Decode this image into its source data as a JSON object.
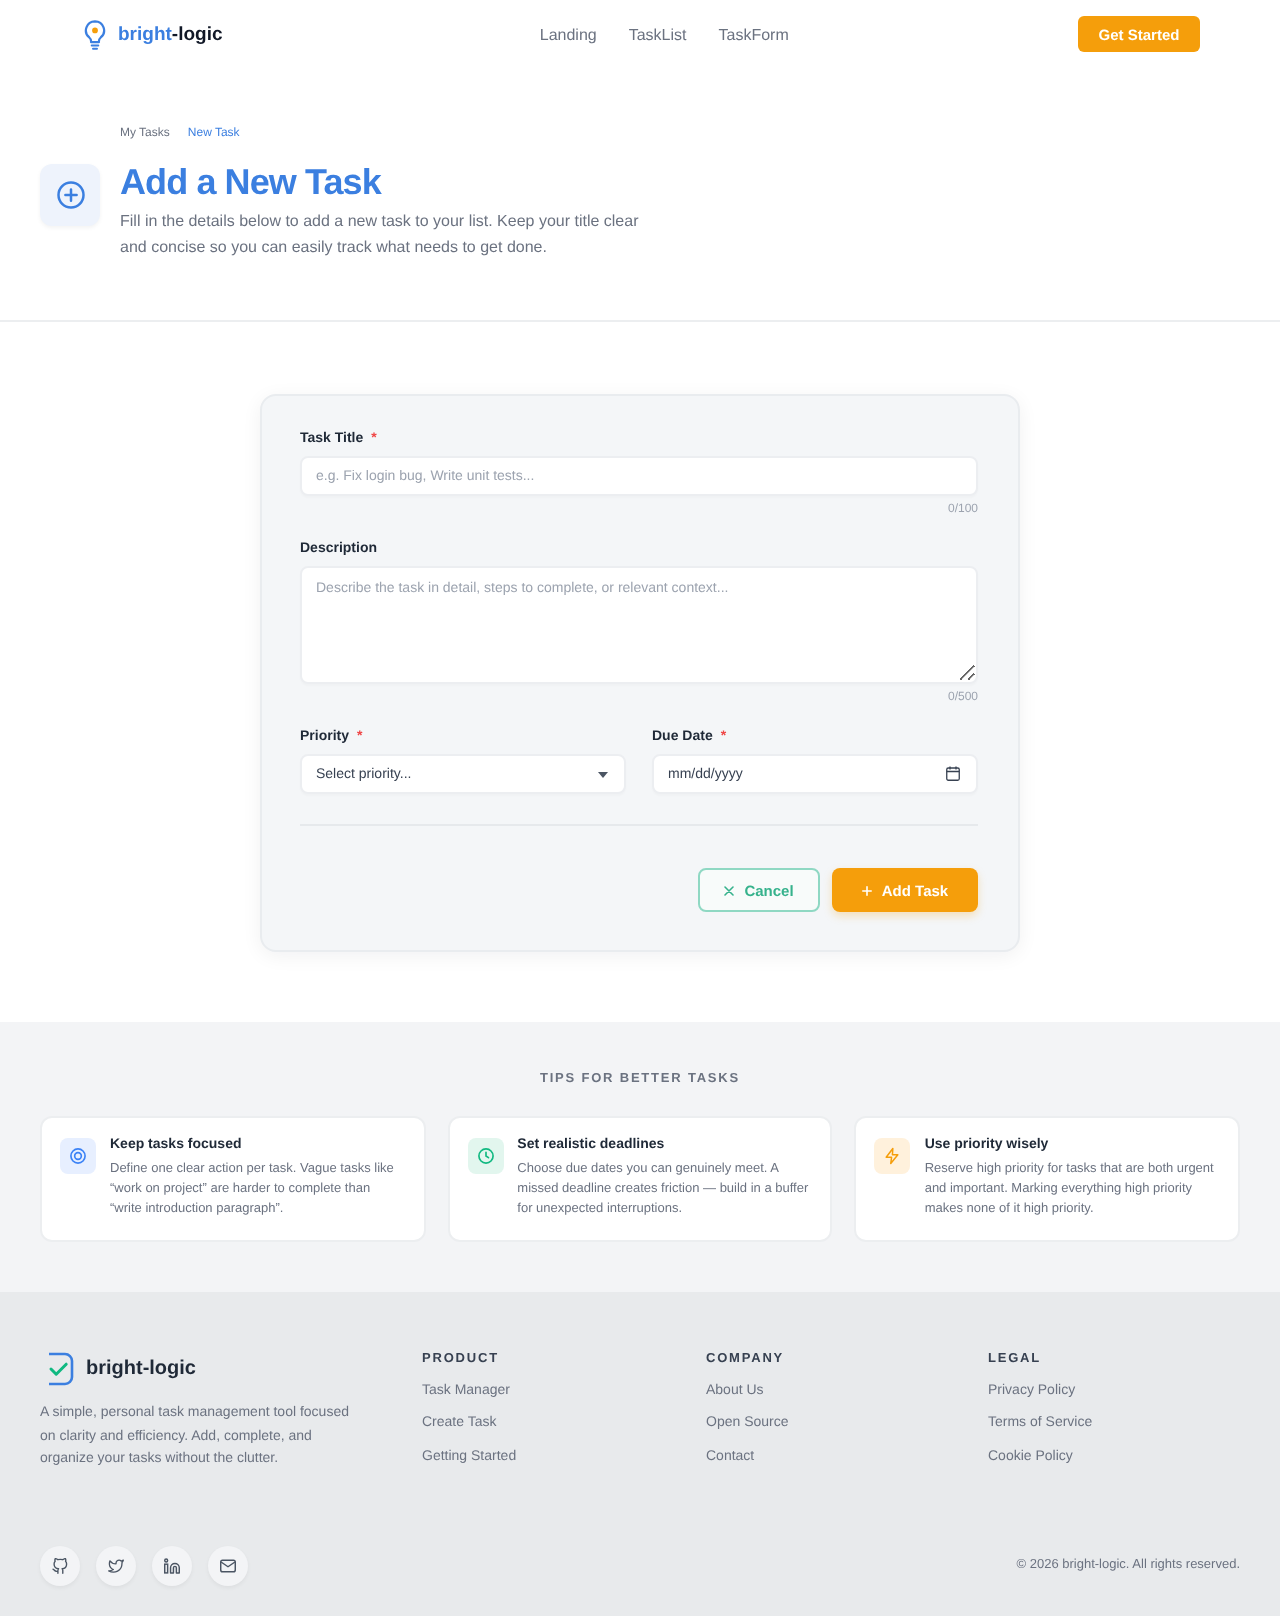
{
  "header": {
    "brand": {
      "accent": "bright",
      "rest": "-logic"
    },
    "nav": [
      {
        "label": "Landing"
      },
      {
        "label": "TaskList"
      },
      {
        "label": "TaskForm"
      }
    ],
    "cta": "Get Started"
  },
  "page_header": {
    "breadcrumb": [
      {
        "label": "My Tasks",
        "current": false
      },
      {
        "label": "New Task",
        "current": true
      }
    ],
    "title": "Add a New Task",
    "subtitle": "Fill in the details below to add a new task to your list. Keep your title clear and concise so you can easily track what needs to get done."
  },
  "form": {
    "fields": [
      {
        "kind": "text",
        "label": "Task Title",
        "required_mark": "*",
        "placeholder": "e.g. Fix login bug, Write unit tests...",
        "counter": "0/100"
      },
      {
        "kind": "textarea",
        "label": "Description",
        "placeholder": "Describe the task in detail, steps to complete, or relevant context...",
        "counter": "0/500"
      },
      {
        "kind": "select",
        "label": "Priority",
        "required_mark": "*",
        "placeholder": "Select priority..."
      },
      {
        "kind": "date",
        "label": "Due Date",
        "required_mark": "*",
        "placeholder": "mm/dd/yyyy"
      }
    ],
    "actions": [
      {
        "kind": "cancel",
        "label": "Cancel"
      },
      {
        "kind": "submit",
        "label": "Add Task"
      }
    ]
  },
  "tips": {
    "heading": "TIPS FOR BETTER TASKS",
    "items": [
      {
        "kind": "focus",
        "title": "Keep tasks focused",
        "text": "Define one clear action per task. Vague tasks like “work on project” are harder to complete than “write introduction paragraph”."
      },
      {
        "kind": "time",
        "title": "Set realistic deadlines",
        "text": "Choose due dates you can genuinely meet. A missed deadline creates friction — build in a buffer for unexpected interruptions."
      },
      {
        "kind": "priority",
        "title": "Use priority wisely",
        "text": "Reserve high priority for tasks that are both urgent and important. Marking everything high priority makes none of it high priority."
      }
    ]
  },
  "footer": {
    "brand": "bright-logic",
    "description": "A simple, personal task management tool focused on clarity and efficiency. Add, complete, and organize your tasks without the clutter.",
    "columns": [
      {
        "heading": "PRODUCT",
        "links": [
          "Task Manager",
          "Create Task",
          "Getting Started"
        ]
      },
      {
        "heading": "COMPANY",
        "links": [
          "About Us",
          "Open Source",
          "Contact"
        ]
      },
      {
        "heading": "LEGAL",
        "links": [
          "Privacy Policy",
          "Terms of Service",
          "Cookie Policy"
        ]
      }
    ],
    "copyright": "© 2026 bright-logic. All rights reserved."
  }
}
